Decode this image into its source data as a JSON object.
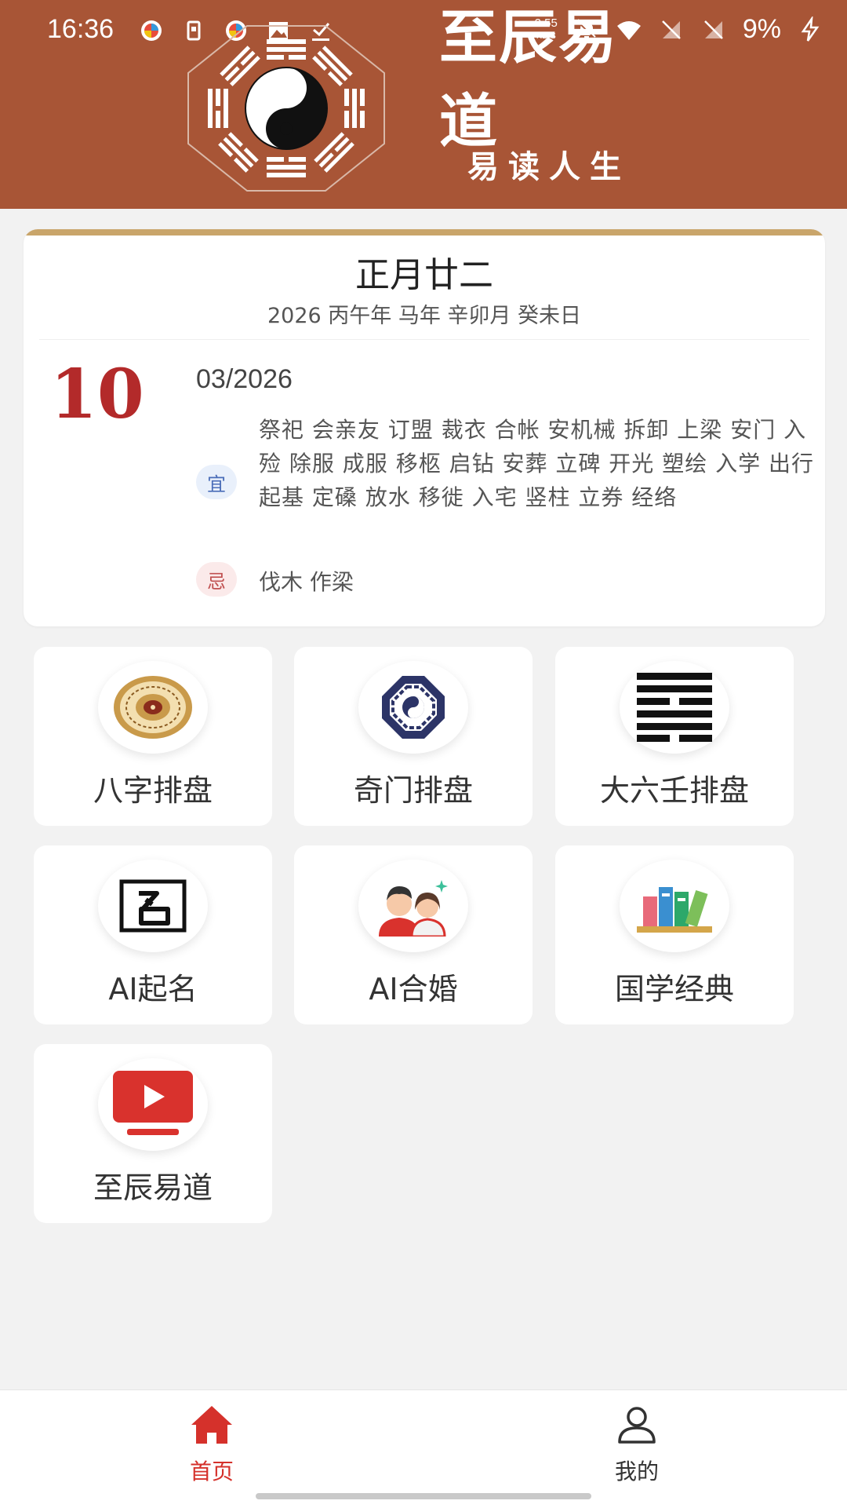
{
  "status_bar": {
    "time": "16:36",
    "net_speed_value": "2.55",
    "net_speed_unit": "KB/S",
    "battery": "9%"
  },
  "header": {
    "logo_title": "至辰易道",
    "logo_subtitle": "易读人生",
    "bg_color": "#a85536"
  },
  "calendar": {
    "lunar_date": "正月廿二",
    "ganzhi": "2026 丙午年 马年 辛卯月 癸未日",
    "day": "10",
    "month_year": "03/2026",
    "yi_label": "宜",
    "yi_items": "祭祀 会亲友 订盟 裁衣 合帐 安机械 拆卸 上梁 安门 入殓 除服 成服 移柩 启钻 安葬 立碑 开光 塑绘 入学 出行 起基 定磉 放水 移徙 入宅 竖柱 立券 经络",
    "ji_label": "忌",
    "ji_items": "伐木 作梁"
  },
  "features": [
    {
      "label": "八字排盘",
      "icon": "bazi-compass-icon"
    },
    {
      "label": "奇门排盘",
      "icon": "qimen-bagua-icon"
    },
    {
      "label": "大六壬排盘",
      "icon": "hexagram-icon"
    },
    {
      "label": "AI起名",
      "icon": "name-seal-icon"
    },
    {
      "label": "AI合婚",
      "icon": "couple-icon"
    },
    {
      "label": "国学经典",
      "icon": "books-icon"
    },
    {
      "label": "至辰易道",
      "icon": "video-play-icon"
    }
  ],
  "bottom_nav": {
    "home_label": "首页",
    "mine_label": "我的",
    "active_color": "#d5312b"
  }
}
